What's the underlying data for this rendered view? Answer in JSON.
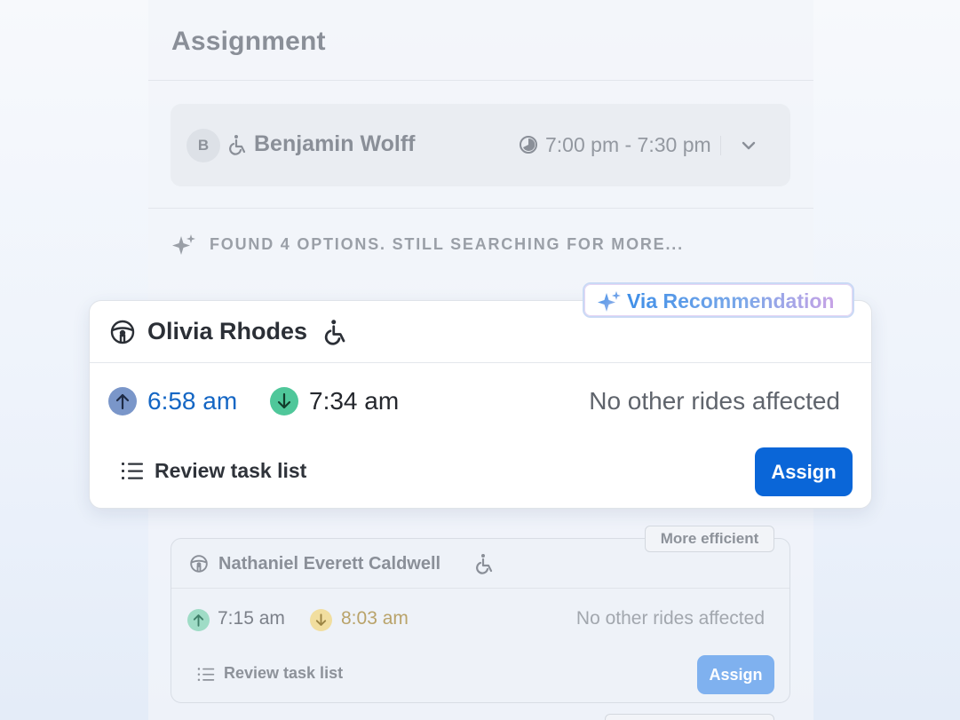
{
  "header": {
    "title": "Assignment"
  },
  "rider": {
    "initial": "B",
    "name": "Benjamin Wolff",
    "time_window": "7:00 pm - 7:30 pm"
  },
  "search_status": "FOUND 4 OPTIONS. STILL SEARCHING FOR MORE...",
  "recommended": {
    "badge": "Via Recommendation",
    "driver": "Olivia Rhodes",
    "pickup_time": "6:58 am",
    "dropoff_time": "7:34 am",
    "impact": "No other rides affected",
    "review_label": "Review task list",
    "assign_label": "Assign",
    "colors": {
      "pickup": "#1466c4",
      "assign_button": "#0a66d8",
      "dropoff_icon": "#4fc79a"
    }
  },
  "option2": {
    "badge": "More efficient",
    "driver": "Nathaniel Everett Caldwell",
    "pickup_time": "7:15 am",
    "dropoff_time": "8:03 am",
    "impact": "No other rides affected",
    "review_label": "Review task list",
    "assign_label": "Assign"
  },
  "icons": {
    "wheelchair": "wheelchair-icon",
    "clock": "clock-icon",
    "chevron": "chevron-down-icon",
    "sparkle": "sparkle-icon",
    "steering": "steering-wheel-icon",
    "pickup": "arrow-up-icon",
    "dropoff": "arrow-down-icon",
    "list": "list-icon"
  }
}
